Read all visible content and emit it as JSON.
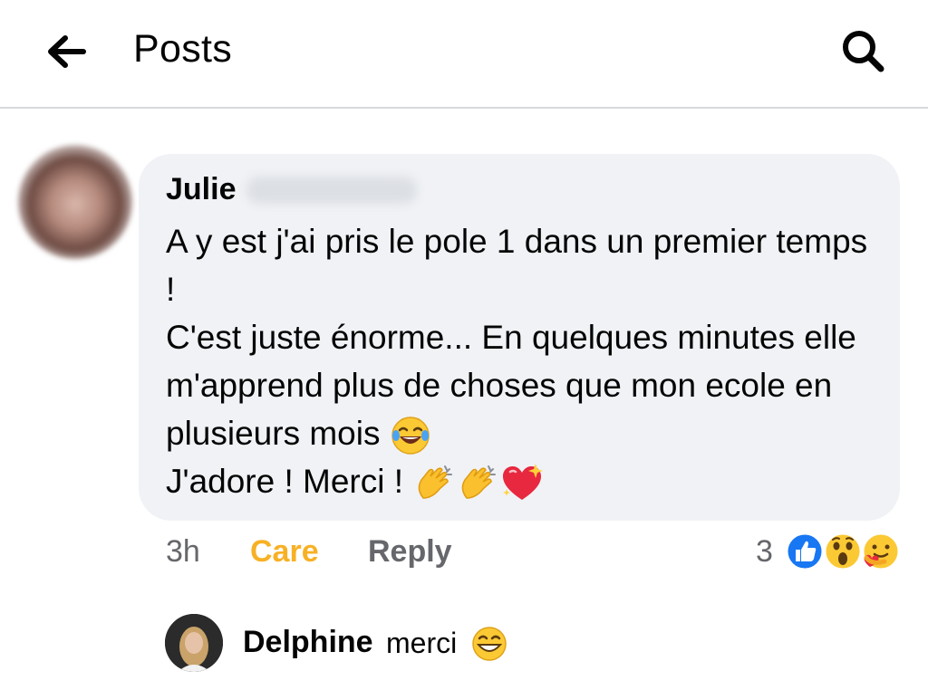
{
  "header": {
    "title": "Posts",
    "back_icon": "arrow-left-icon",
    "search_icon": "search-icon"
  },
  "comment": {
    "author_first_name": "Julie",
    "body_lines": [
      "A y est j'ai pris le pole 1 dans un premier temps !",
      "C'est juste énorme... En quelques minutes elle m'apprend plus de choses que mon ecole en plusieurs mois",
      "J'adore ! Merci !"
    ],
    "emojis": [
      "face-with-tears-of-joy-icon",
      "clapping-hands-icon",
      "clapping-hands-icon",
      "sparkling-heart-icon"
    ],
    "time": "3h",
    "reaction_label": "Care",
    "reply_label": "Reply",
    "reaction_count": "3",
    "reaction_icons": [
      "like-icon",
      "wow-icon",
      "care-icon"
    ],
    "reaction_color": "#f7b125"
  },
  "reply": {
    "author": "Delphine",
    "text": "merci",
    "emoji": "grinning-face-icon"
  }
}
